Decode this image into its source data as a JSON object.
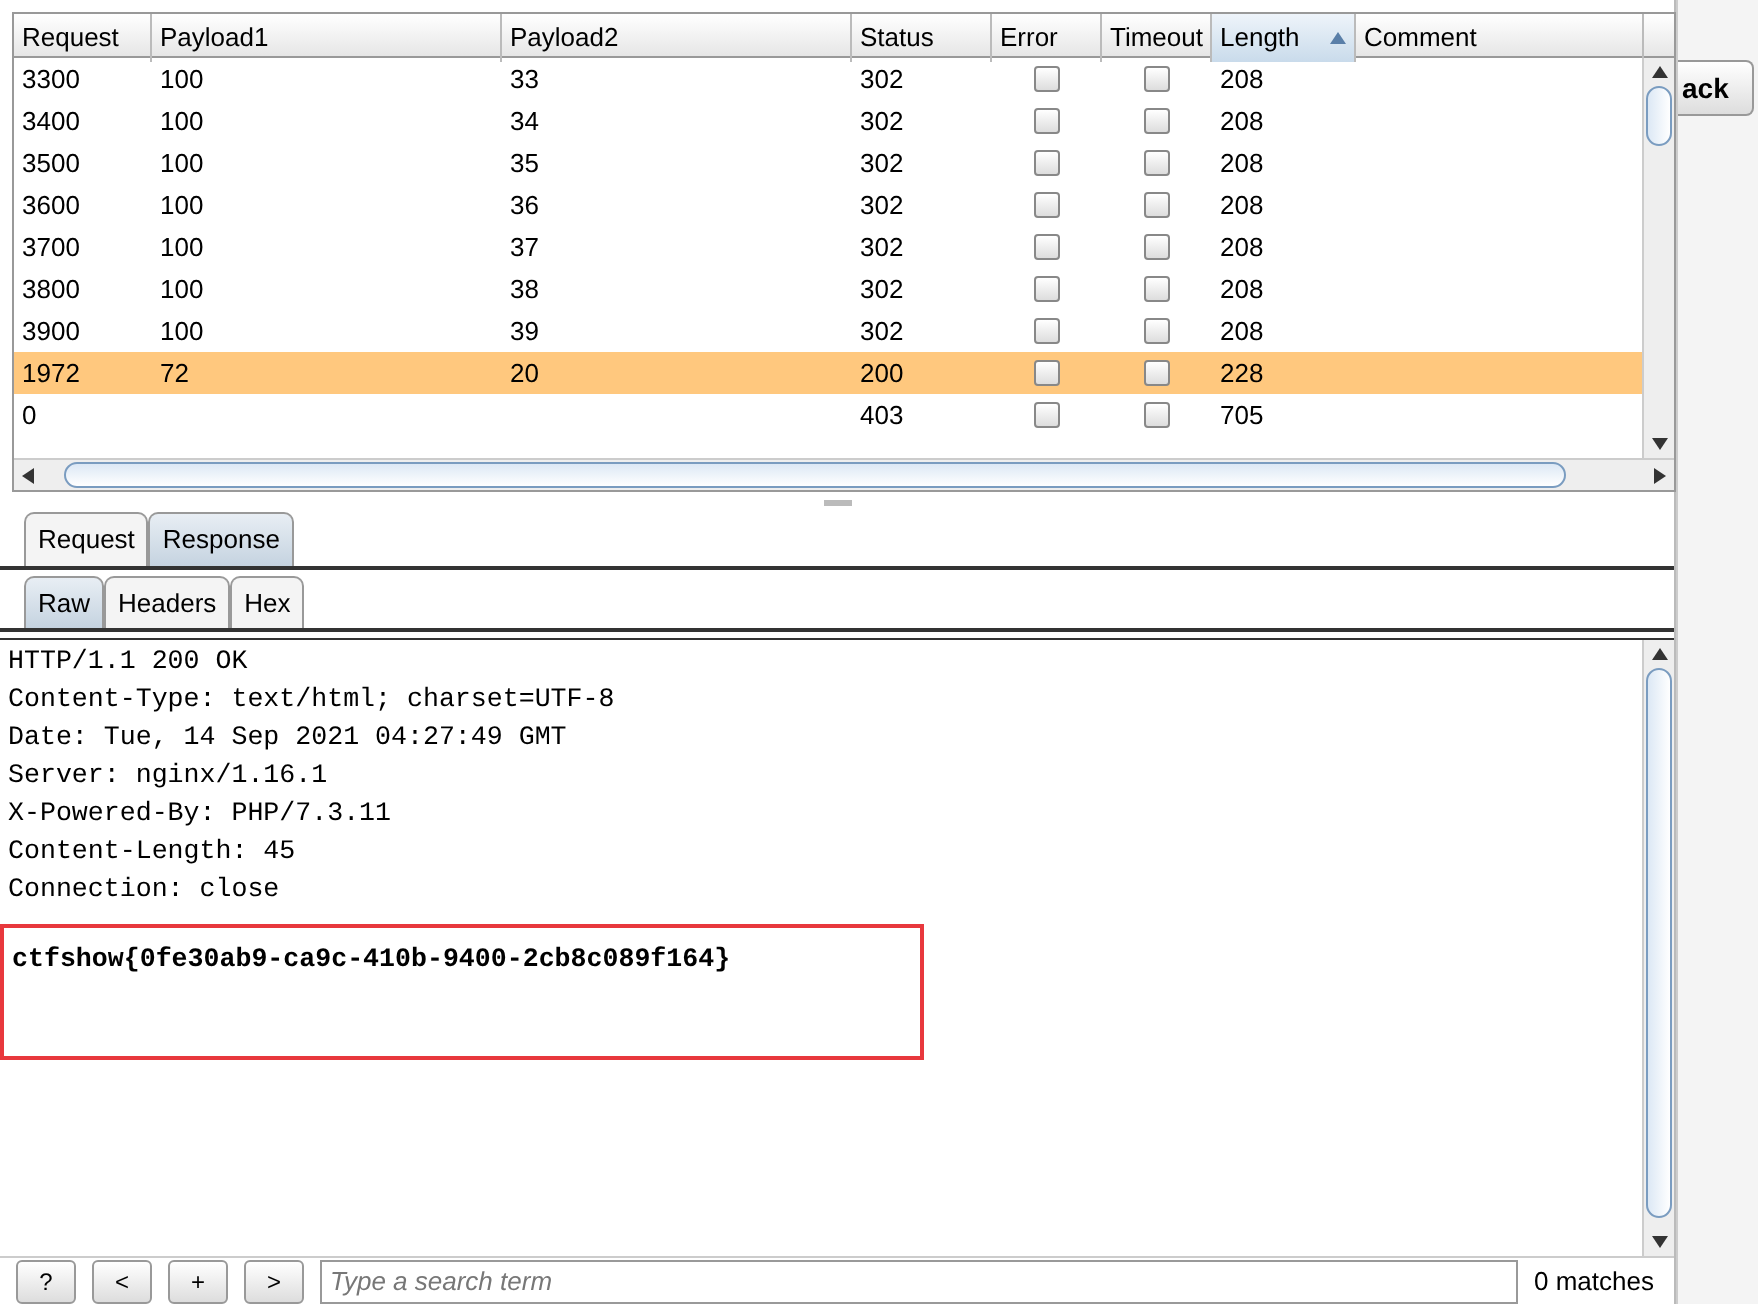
{
  "results_table": {
    "columns": [
      {
        "label": "Request",
        "sorted": false
      },
      {
        "label": "Payload1",
        "sorted": false
      },
      {
        "label": "Payload2",
        "sorted": false
      },
      {
        "label": "Status",
        "sorted": false
      },
      {
        "label": "Error",
        "sorted": false
      },
      {
        "label": "Timeout",
        "sorted": false
      },
      {
        "label": "Length",
        "sorted": true
      },
      {
        "label": "Comment",
        "sorted": false
      }
    ],
    "rows": [
      {
        "request": "3300",
        "payload1": "100",
        "payload2": "33",
        "status": "302",
        "error": false,
        "timeout": false,
        "length": "208",
        "selected": false
      },
      {
        "request": "3400",
        "payload1": "100",
        "payload2": "34",
        "status": "302",
        "error": false,
        "timeout": false,
        "length": "208",
        "selected": false
      },
      {
        "request": "3500",
        "payload1": "100",
        "payload2": "35",
        "status": "302",
        "error": false,
        "timeout": false,
        "length": "208",
        "selected": false
      },
      {
        "request": "3600",
        "payload1": "100",
        "payload2": "36",
        "status": "302",
        "error": false,
        "timeout": false,
        "length": "208",
        "selected": false
      },
      {
        "request": "3700",
        "payload1": "100",
        "payload2": "37",
        "status": "302",
        "error": false,
        "timeout": false,
        "length": "208",
        "selected": false
      },
      {
        "request": "3800",
        "payload1": "100",
        "payload2": "38",
        "status": "302",
        "error": false,
        "timeout": false,
        "length": "208",
        "selected": false
      },
      {
        "request": "3900",
        "payload1": "100",
        "payload2": "39",
        "status": "302",
        "error": false,
        "timeout": false,
        "length": "208",
        "selected": false
      },
      {
        "request": "1972",
        "payload1": "72",
        "payload2": "20",
        "status": "200",
        "error": false,
        "timeout": false,
        "length": "228",
        "selected": true
      },
      {
        "request": "0",
        "status": "403",
        "error": false,
        "timeout": false,
        "length": "705",
        "selected": false
      }
    ]
  },
  "side_button": {
    "label": "ack"
  },
  "message_tabs": [
    {
      "label": "Request",
      "selected": false
    },
    {
      "label": "Response",
      "selected": true
    }
  ],
  "view_tabs": [
    {
      "label": "Raw",
      "selected": true
    },
    {
      "label": "Headers",
      "selected": false
    },
    {
      "label": "Hex",
      "selected": false
    }
  ],
  "response_lines": [
    "HTTP/1.1 200 OK",
    "Content-Type: text/html; charset=UTF-8",
    "Date: Tue, 14 Sep 2021 04:27:49 GMT",
    "Server: nginx/1.16.1",
    "X-Powered-By: PHP/7.3.11",
    "Content-Length: 45",
    "Connection: close"
  ],
  "highlighted_body": "ctfshow{0fe30ab9-ca9c-410b-9400-2cb8c089f164}",
  "search": {
    "buttons": [
      "?",
      "<",
      "+",
      ">"
    ],
    "placeholder": "Type a search term",
    "matches": "0 matches"
  }
}
